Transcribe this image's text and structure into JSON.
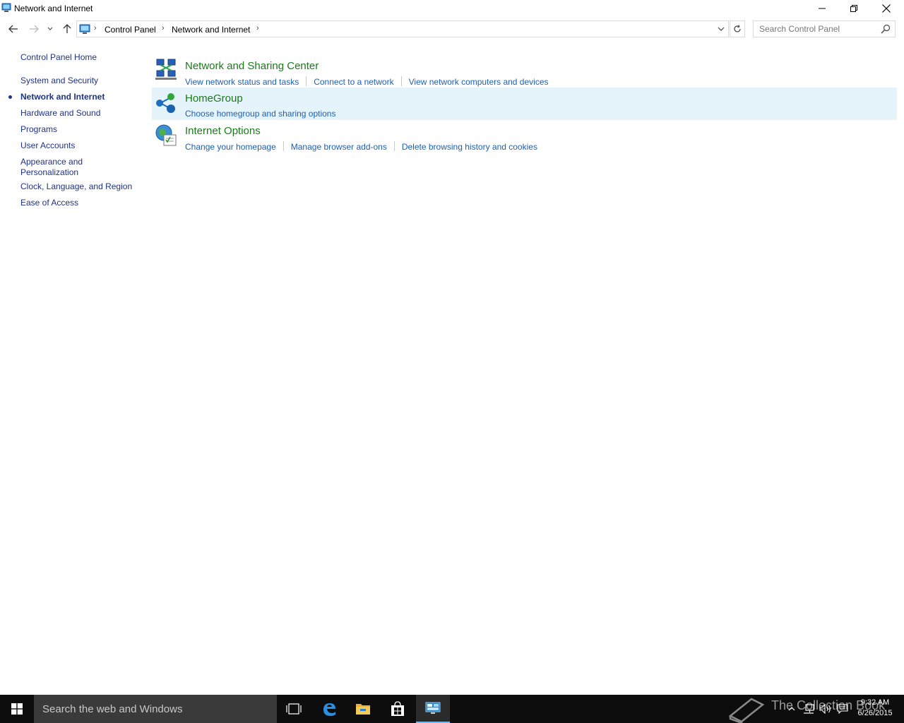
{
  "window": {
    "title": "Network and Internet",
    "icon": "control-panel-icon",
    "controls": [
      "minimize-icon",
      "restore-icon",
      "close-icon"
    ]
  },
  "address": {
    "breadcrumbs": [
      "Control Panel",
      "Network and Internet"
    ],
    "search_placeholder": "Search Control Panel"
  },
  "leftnav": {
    "home": "Control Panel Home",
    "items": [
      {
        "label": "System and Security"
      },
      {
        "label": "Network and Internet",
        "active": true
      },
      {
        "label": "Hardware and Sound"
      },
      {
        "label": "Programs"
      },
      {
        "label": "User Accounts"
      },
      {
        "label": "Appearance and"
      },
      {
        "label": "Personalization"
      },
      {
        "label": "Clock, Language, and Region"
      },
      {
        "label": "Ease of Access"
      }
    ]
  },
  "sections": [
    {
      "title": "Network and Sharing Center",
      "icon": "network-sharing-icon",
      "links": [
        "View network status and tasks",
        "Connect to a network",
        "View network computers and devices"
      ]
    },
    {
      "title": "HomeGroup",
      "icon": "homegroup-icon",
      "highlighted": true,
      "links": [
        "Choose homegroup and sharing options"
      ]
    },
    {
      "title": "Internet Options",
      "icon": "internet-options-icon",
      "links": [
        "Change your homepage",
        "Manage browser add-ons",
        "Delete browsing history and cookies"
      ]
    }
  ],
  "taskbar": {
    "search_text": "Search the web and Windows",
    "watermark": "The Collection Book",
    "time": "9:32 AM",
    "date": "6/26/2015"
  },
  "colors": {
    "link": "#1f5fb0",
    "heading": "#1a7a1a",
    "nav": "#1e3287",
    "highlight": "#e5f3fb",
    "taskbar": "#0d0d0d"
  }
}
